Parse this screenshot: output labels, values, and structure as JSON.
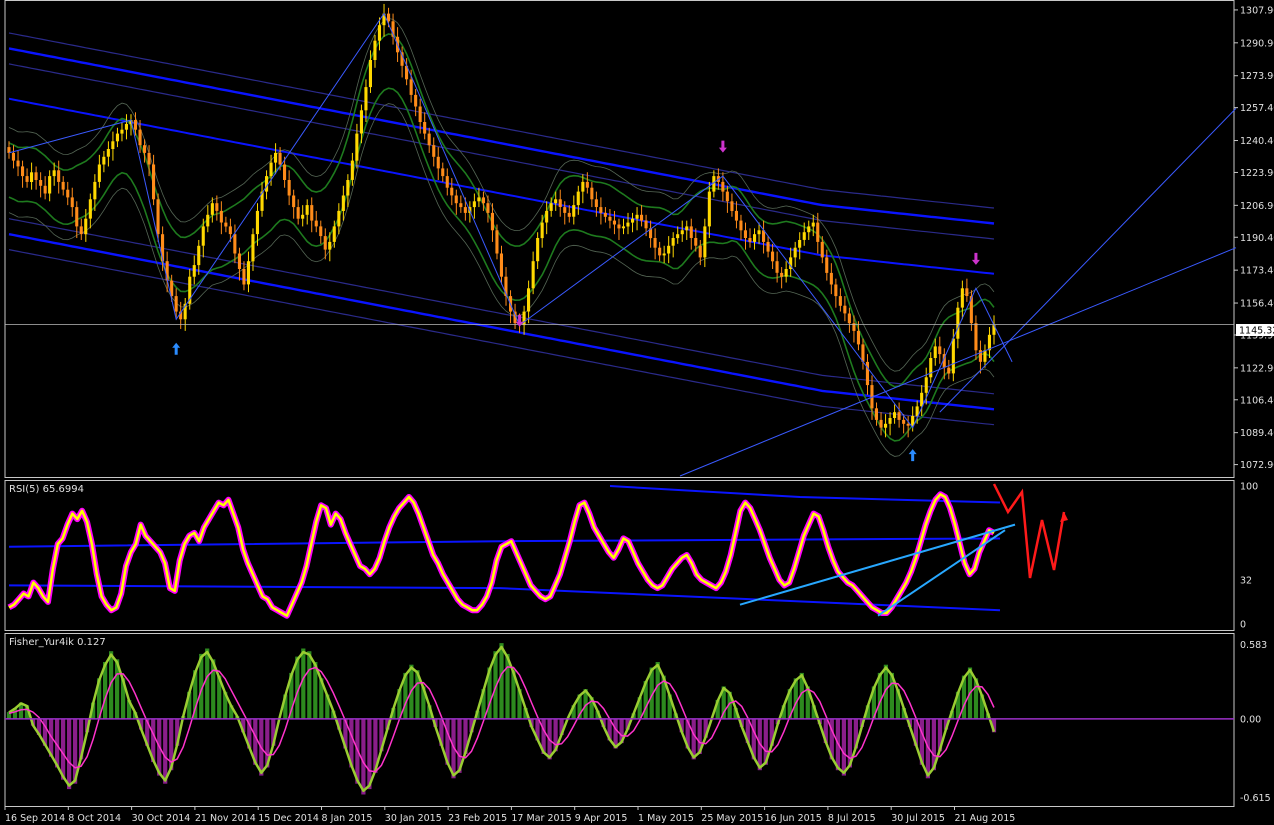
{
  "colors": {
    "background": "#000000",
    "frame": "#c8c8c8",
    "bull_candle": "#ffd800",
    "bear_candle": "#ff8c1a",
    "envelope_blue": "#0a14ff",
    "envelope_dark": "#2a2a8a",
    "bollinger_green": "#1e7a1e",
    "rsi_line": "#ffff00",
    "rsi_glow": "#ff00ff",
    "fisher_pos": "#2d8a1e",
    "fisher_neg": "#8a1e8a",
    "fisher_line": "#9acd32",
    "fisher_signal": "#ff33cc",
    "trendline": "#3a5aff",
    "rsi_trend": "#28a8ff",
    "forecast": "#ff1a1a",
    "arrow_up": "#2b8cff",
    "arrow_down": "#cc33cc"
  },
  "price_panel": {
    "current_price_label": "1145.32",
    "current_price": 1145.32,
    "y_ticks": [
      "1307.90",
      "1290.90",
      "1273.90",
      "1257.40",
      "1240.40",
      "1223.90",
      "1206.90",
      "1190.40",
      "1173.40",
      "1156.40",
      "1139.90",
      "1122.90",
      "1106.40",
      "1089.40",
      "1072.90"
    ]
  },
  "rsi_panel": {
    "title": "RSI(5) 65.6994",
    "y_ticks": [
      "100",
      "32",
      "0"
    ]
  },
  "fisher_panel": {
    "title": "Fisher_Yur4ik 0.127",
    "y_ticks": [
      "0.583",
      "0.00",
      "-0.615"
    ],
    "zero_label": "0.00"
  },
  "x_axis": {
    "labels": [
      "16 Sep 2014",
      "8 Oct 2014",
      "30 Oct 2014",
      "21 Nov 2014",
      "15 Dec 2014",
      "8 Jan 2015",
      "30 Jan 2015",
      "23 Feb 2015",
      "17 Mar 2015",
      "9 Apr 2015",
      "1 May 2015",
      "25 May 2015",
      "16 Jun 2015",
      "8 Jul 2015",
      "30 Jul 2015",
      "21 Aug 2015"
    ]
  },
  "chart_data": [
    {
      "type": "candlestick",
      "title": "",
      "ylim": [
        1067.0,
        1312.0
      ],
      "y_ticks": [
        1307.9,
        1290.9,
        1273.9,
        1257.4,
        1240.4,
        1223.9,
        1206.9,
        1190.4,
        1173.4,
        1156.4,
        1139.9,
        1122.9,
        1106.4,
        1089.4,
        1072.9
      ],
      "close": [
        1234,
        1230,
        1227,
        1222,
        1219,
        1224,
        1220,
        1217,
        1213,
        1222,
        1225,
        1219,
        1215,
        1211,
        1206,
        1196,
        1192,
        1200,
        1210,
        1219,
        1228,
        1232,
        1236,
        1240,
        1244,
        1246,
        1249,
        1251,
        1246,
        1238,
        1234,
        1228,
        1210,
        1192,
        1178,
        1168,
        1160,
        1152,
        1148,
        1156,
        1170,
        1176,
        1186,
        1196,
        1202,
        1208,
        1204,
        1198,
        1196,
        1192,
        1182,
        1174,
        1166,
        1178,
        1192,
        1204,
        1214,
        1222,
        1229,
        1234,
        1228,
        1220,
        1212,
        1206,
        1200,
        1202,
        1207,
        1199,
        1196,
        1191,
        1184,
        1188,
        1196,
        1204,
        1212,
        1220,
        1230,
        1244,
        1256,
        1268,
        1282,
        1292,
        1300,
        1306,
        1302,
        1294,
        1286,
        1279,
        1272,
        1264,
        1258,
        1250,
        1244,
        1238,
        1232,
        1226,
        1222,
        1216,
        1212,
        1208,
        1206,
        1203,
        1206,
        1209,
        1211,
        1208,
        1203,
        1194,
        1182,
        1170,
        1160,
        1152,
        1146,
        1145,
        1152,
        1164,
        1178,
        1190,
        1198,
        1204,
        1208,
        1210,
        1206,
        1203,
        1201,
        1207,
        1214,
        1219,
        1216,
        1210,
        1206,
        1203,
        1201,
        1199,
        1197,
        1195,
        1196,
        1198,
        1200,
        1202,
        1199,
        1195,
        1190,
        1185,
        1181,
        1182,
        1186,
        1190,
        1192,
        1194,
        1196,
        1190,
        1186,
        1180,
        1196,
        1214,
        1222,
        1219,
        1214,
        1209,
        1204,
        1199,
        1194,
        1190,
        1188,
        1192,
        1194,
        1188,
        1183,
        1178,
        1172,
        1170,
        1174,
        1180,
        1185,
        1189,
        1193,
        1196,
        1198,
        1188,
        1180,
        1172,
        1166,
        1160,
        1155,
        1151,
        1146,
        1142,
        1135,
        1126,
        1114,
        1102,
        1096,
        1092,
        1094,
        1097,
        1100,
        1096,
        1094,
        1093,
        1098,
        1103,
        1110,
        1118,
        1128,
        1134,
        1130,
        1123,
        1120,
        1138,
        1154,
        1164,
        1160,
        1146,
        1132,
        1126,
        1132,
        1140,
        1145
      ]
    },
    {
      "type": "line",
      "title": "RSI(5) 65.6994",
      "ylim": [
        0,
        100
      ],
      "y_ticks": [
        100,
        32,
        0
      ],
      "series": [
        {
          "name": "RSI(5)",
          "values": [
            12,
            14,
            18,
            22,
            20,
            30,
            26,
            20,
            16,
            40,
            58,
            62,
            72,
            80,
            76,
            82,
            74,
            58,
            36,
            20,
            14,
            10,
            12,
            22,
            42,
            52,
            58,
            72,
            64,
            60,
            56,
            52,
            44,
            26,
            24,
            46,
            58,
            64,
            66,
            60,
            70,
            76,
            82,
            88,
            86,
            90,
            80,
            70,
            54,
            44,
            36,
            28,
            20,
            18,
            12,
            10,
            8,
            6,
            14,
            22,
            30,
            42,
            58,
            74,
            86,
            84,
            72,
            80,
            76,
            66,
            58,
            50,
            42,
            40,
            36,
            40,
            48,
            60,
            70,
            78,
            84,
            88,
            92,
            88,
            80,
            70,
            60,
            50,
            44,
            36,
            30,
            24,
            18,
            14,
            12,
            10,
            10,
            14,
            20,
            30,
            46,
            56,
            58,
            60,
            52,
            44,
            36,
            28,
            24,
            20,
            18,
            20,
            28,
            36,
            48,
            60,
            74,
            86,
            88,
            80,
            70,
            64,
            58,
            52,
            48,
            54,
            62,
            60,
            52,
            44,
            38,
            32,
            28,
            26,
            28,
            34,
            40,
            44,
            48,
            50,
            44,
            36,
            32,
            30,
            28,
            26,
            30,
            38,
            50,
            66,
            82,
            88,
            84,
            76,
            68,
            58,
            48,
            40,
            32,
            28,
            30,
            40,
            52,
            64,
            72,
            80,
            78,
            68,
            56,
            46,
            38,
            34,
            30,
            28,
            24,
            20,
            16,
            12,
            10,
            8,
            8,
            12,
            18,
            24,
            30,
            38,
            48,
            60,
            72,
            82,
            90,
            94,
            92,
            84,
            72,
            58,
            44,
            36,
            40,
            52,
            60,
            68,
            66
          ]
        }
      ]
    },
    {
      "type": "bar",
      "title": "Fisher_Yur4ik 0.127",
      "ylim": [
        -0.615,
        0.583
      ],
      "y_ticks": [
        0.583,
        0.0,
        -0.615
      ],
      "series": [
        {
          "name": "Fisher_Yur4ik",
          "values": [
            0.05,
            0.08,
            0.12,
            0.1,
            -0.05,
            -0.12,
            -0.2,
            -0.28,
            -0.36,
            -0.45,
            -0.52,
            -0.48,
            -0.3,
            -0.1,
            0.12,
            0.3,
            0.42,
            0.5,
            0.44,
            0.3,
            0.14,
            0.05,
            -0.08,
            -0.2,
            -0.32,
            -0.42,
            -0.48,
            -0.38,
            -0.2,
            0.02,
            0.2,
            0.36,
            0.48,
            0.52,
            0.44,
            0.32,
            0.2,
            0.1,
            0.02,
            -0.1,
            -0.22,
            -0.34,
            -0.42,
            -0.36,
            -0.2,
            0.0,
            0.18,
            0.34,
            0.46,
            0.52,
            0.5,
            0.42,
            0.3,
            0.18,
            0.06,
            -0.08,
            -0.22,
            -0.36,
            -0.48,
            -0.56,
            -0.52,
            -0.4,
            -0.24,
            -0.08,
            0.08,
            0.22,
            0.34,
            0.4,
            0.36,
            0.24,
            0.1,
            -0.06,
            -0.2,
            -0.34,
            -0.44,
            -0.4,
            -0.26,
            -0.1,
            0.06,
            0.22,
            0.38,
            0.5,
            0.56,
            0.48,
            0.36,
            0.22,
            0.08,
            -0.06,
            -0.16,
            -0.26,
            -0.3,
            -0.24,
            -0.12,
            0.0,
            0.1,
            0.18,
            0.22,
            0.16,
            0.06,
            -0.06,
            -0.16,
            -0.22,
            -0.18,
            -0.08,
            0.04,
            0.16,
            0.28,
            0.38,
            0.42,
            0.32,
            0.18,
            0.04,
            -0.1,
            -0.22,
            -0.3,
            -0.26,
            -0.14,
            0.0,
            0.14,
            0.24,
            0.2,
            0.08,
            -0.06,
            -0.18,
            -0.3,
            -0.38,
            -0.34,
            -0.2,
            -0.04,
            0.1,
            0.22,
            0.3,
            0.34,
            0.24,
            0.1,
            -0.04,
            -0.18,
            -0.3,
            -0.38,
            -0.42,
            -0.36,
            -0.22,
            -0.06,
            0.1,
            0.24,
            0.34,
            0.4,
            0.34,
            0.22,
            0.08,
            -0.06,
            -0.2,
            -0.34,
            -0.44,
            -0.38,
            -0.24,
            -0.08,
            0.06,
            0.2,
            0.32,
            0.38,
            0.3,
            0.18,
            0.04,
            -0.1
          ]
        }
      ]
    }
  ]
}
